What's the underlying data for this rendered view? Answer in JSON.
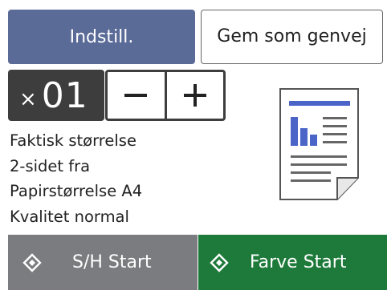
{
  "top_buttons": {
    "settings_label": "Indstill.",
    "shortcut_label": "Gem som genvej"
  },
  "copies": {
    "prefix": "×",
    "count": "01",
    "decrement_icon": "minus-icon",
    "increment_icon": "plus-icon"
  },
  "settings_info": {
    "lines": [
      "Faktisk størrelse",
      "2-sidet fra",
      "Papirstørrelse A4",
      "Kvalitet normal"
    ]
  },
  "preview": {
    "icon": "document-preview-icon"
  },
  "start_buttons": {
    "mono_label": "S/H Start",
    "color_label": "Farve Start",
    "icon": "diamond-start-icon"
  },
  "colors": {
    "settings_button": "#5b6b98",
    "copies_box": "#3d3d3d",
    "mono_start": "#7a7c7f",
    "color_start": "#1e7a3a",
    "preview_accent": "#4a64c8"
  }
}
